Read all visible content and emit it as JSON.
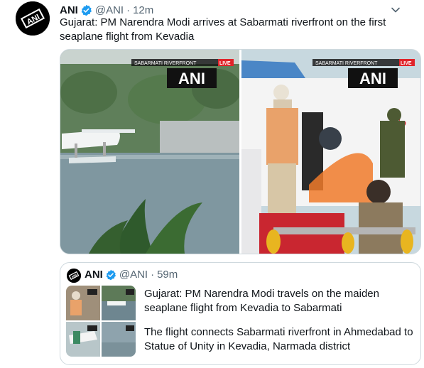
{
  "tweet": {
    "author_name": "ANI",
    "handle": "@ANI",
    "separator": "·",
    "time": "12m",
    "text": "Gujarat: PM Narendra Modi arrives at Sabarmati riverfront on the first seaplane flight from Kevadia",
    "media": {
      "left_overlay_label": "SABARMATI RIVERFRONT",
      "left_overlay_live": "LIVE",
      "left_logo": "ANI",
      "right_overlay_label": "SABARMATI RIVERFRONT",
      "right_overlay_live": "LIVE",
      "right_logo": "ANI"
    }
  },
  "quoted": {
    "author_name": "ANI",
    "handle": "@ANI",
    "separator": "·",
    "time": "59m",
    "paragraph1": "Gujarat: PM Narendra Modi travels on the maiden seaplane flight from Kevadia to Sabarmati",
    "paragraph2": "The flight connects Sabarmati riverfront in Ahmedabad to Statue of Unity in Kevadia, Narmada district"
  },
  "avatar_text": "ANI",
  "colors": {
    "verified": "#1d9bf0",
    "live": "#e0242a"
  },
  "icons": [
    "verified-badge-icon",
    "chevron-down-icon"
  ]
}
